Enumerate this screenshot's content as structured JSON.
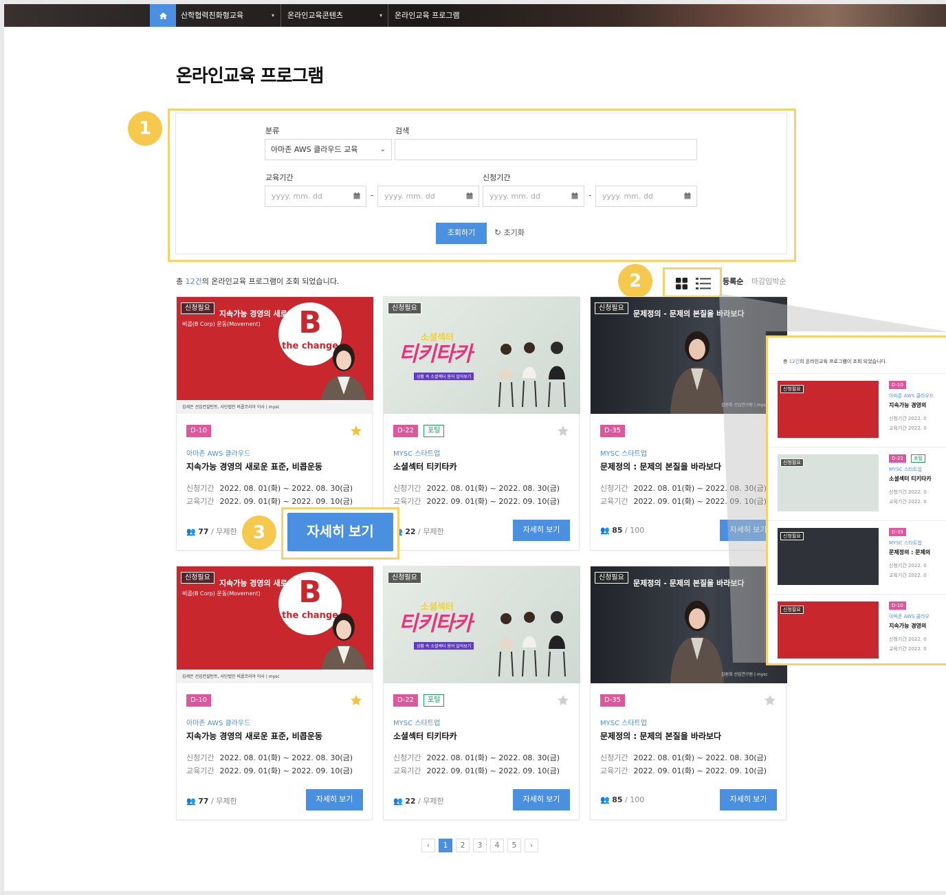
{
  "nav": {
    "items": [
      "산학협력친화형교육",
      "온라인교육콘텐츠",
      "온라인교육 프로그램"
    ]
  },
  "page_title": "온라인교육 프로그램",
  "filter": {
    "category_label": "분류",
    "category_value": "아마존 AWS 클라우드 교육",
    "search_label": "검색",
    "search_value": "",
    "edu_period_label": "교육기간",
    "apply_period_label": "신청기간",
    "date_placeholder": "yyyy. mm. dd",
    "dash": "-",
    "search_button": "조회하기",
    "reset_button": "초기화"
  },
  "callouts": [
    "1",
    "2",
    "3"
  ],
  "result": {
    "prefix": "총 ",
    "count": "12건",
    "suffix": "의 온라인교육 프로그램이 조회 되었습니다.",
    "sort_active": "등록순",
    "sort_other": "마감임박순"
  },
  "thumb_text": {
    "apply_tag": "신청필요",
    "b_title": "지속가능 경영의 새로운 표준",
    "b_sub": "비콥(B Corp) 운동(Movement)",
    "b_logo": "B",
    "b_slogan": "the change",
    "b_footer": "김세은 선임컨설턴트, 사단법인 비콥코리아 이사 | mysc",
    "tiki_top": "소셜섹터",
    "tiki_main": "티키타카",
    "tiki_sub": "상황 속 소셜섹터 용어 알아보기",
    "dark_title": "문제정의 - 문제의 본질을 바라보다",
    "dark_footer": "김원희 선임연구원 | mysc"
  },
  "cards": [
    {
      "dday": "D-10",
      "portal": "",
      "starred": true,
      "category": "아마존 AWS 클라우드",
      "title": "지속가능 경영의 새로운 표준, 비콥운동",
      "apply_key": "신청기간",
      "apply_val": "2022. 08. 01(화) ~ 2022. 08. 30(금)",
      "edu_key": "교육기간",
      "edu_val": "2022. 09. 01(화) ~ 2022. 09. 10(금)",
      "count": "77",
      "limit": " / 무제한",
      "button": "자세히 보기"
    },
    {
      "dday": "D-22",
      "portal": "포털",
      "starred": false,
      "category": "MYSC 스타트업",
      "title": "소셜섹터 티키타카",
      "apply_key": "신청기간",
      "apply_val": "2022. 08. 01(화) ~ 2022. 08. 30(금)",
      "edu_key": "교육기간",
      "edu_val": "2022. 09. 01(화) ~ 2022. 09. 10(금)",
      "count": "22",
      "limit": " / 무제한",
      "button": "자세히 보기"
    },
    {
      "dday": "D-35",
      "portal": "",
      "starred": false,
      "category": "MYSC 스타트업",
      "title": "문제정의 : 문제의 본질을 바라보다",
      "apply_key": "신청기간",
      "apply_val": "2022. 08. 01(화) ~ 2022. 08. 30(금)",
      "edu_key": "교육기간",
      "edu_val": "2022. 09. 01(화) ~ 2022. 09. 10(금)",
      "count": "85",
      "limit": " / 100",
      "button": "자세히 보기"
    },
    {
      "dday": "D-10",
      "portal": "",
      "starred": true,
      "category": "아마존 AWS 클라우드",
      "title": "지속가능 경영의 새로운 표준, 비콥운동",
      "apply_key": "신청기간",
      "apply_val": "2022. 08. 01(화) ~ 2022. 08. 30(금)",
      "edu_key": "교육기간",
      "edu_val": "2022. 09. 01(화) ~ 2022. 09. 10(금)",
      "count": "77",
      "limit": " / 무제한",
      "button": "자세히 보기"
    },
    {
      "dday": "D-22",
      "portal": "포털",
      "starred": false,
      "category": "MYSC 스타트업",
      "title": "소셜섹터 티키타카",
      "apply_key": "신청기간",
      "apply_val": "2022. 08. 01(화) ~ 2022. 08. 30(금)",
      "edu_key": "교육기간",
      "edu_val": "2022. 09. 01(화) ~ 2022. 09. 10(금)",
      "count": "22",
      "limit": " / 무제한",
      "button": "자세히 보기"
    },
    {
      "dday": "D-35",
      "portal": "",
      "starred": false,
      "category": "MYSC 스타트업",
      "title": "문제정의 : 문제의 본질을 바라보다",
      "apply_key": "신청기간",
      "apply_val": "2022. 08. 01(화) ~ 2022. 08. 30(금)",
      "edu_key": "교육기간",
      "edu_val": "2022. 09. 01(화) ~ 2022. 09. 10(금)",
      "count": "85",
      "limit": " / 100",
      "button": "자세히 보기"
    }
  ],
  "detail_big_button": "자세히 보기",
  "inset": {
    "rows": [
      {
        "dday": "D-10",
        "portal": "",
        "category": "아마존 AWS 클라우드",
        "title": "지속가능 경영의",
        "apply": "신청기간  2022. 0",
        "edu": "교육기간  2022. 0"
      },
      {
        "dday": "D-22",
        "portal": "포털",
        "category": "MYSC 스타트업",
        "title": "소셜섹터 티키타카",
        "apply": "신청기간  2022. 0",
        "edu": "교육기간  2022. 0"
      },
      {
        "dday": "D-35",
        "portal": "",
        "category": "MYSC 스타트업",
        "title": "문제정의 : 문제의",
        "apply": "신청기간  2022. 0",
        "edu": "교육기간  2022. 0"
      },
      {
        "dday": "D-10",
        "portal": "",
        "category": "아마존 AWS 클라우",
        "title": "지속가능 경영의",
        "apply": "신청기간  2022. 0",
        "edu": "교육기간  2022. 0"
      }
    ]
  },
  "pagination": {
    "prev": "‹",
    "pages": [
      "1",
      "2",
      "3",
      "4",
      "5"
    ],
    "active": "1",
    "next": "›"
  },
  "colors": {
    "primary": "#4a8fe0",
    "highlight": "#f6d06a",
    "callout": "#f6c94e",
    "dday": "#e0559c",
    "portal": "#1a9e57",
    "star_on": "#f6c23e",
    "star_off": "#cfcfcf"
  }
}
